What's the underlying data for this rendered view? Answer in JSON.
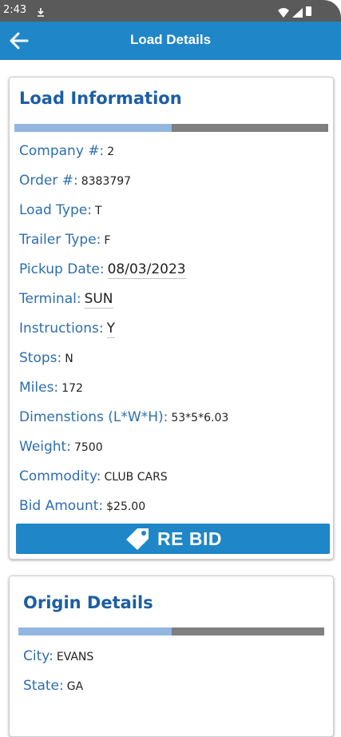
{
  "status_bar": {
    "time": "2:43",
    "notification_icon": "download-status-icon",
    "wifi_icon": "wifi-icon",
    "signal_icon": "cell-signal-icon",
    "battery_icon": "battery-icon"
  },
  "app_bar": {
    "title": "Load Details",
    "back_icon": "arrow-left-icon",
    "color": "#1f86c7"
  },
  "load_information": {
    "title": "Load Information",
    "progress_fraction": 0.5,
    "fields": [
      {
        "label": "Company #:",
        "value": "2"
      },
      {
        "label": "Order #:",
        "value": "8383797"
      },
      {
        "label": "Load Type:",
        "value": "T"
      },
      {
        "label": "Trailer Type:",
        "value": "F"
      },
      {
        "label": "Pickup Date:",
        "value": "08/03/2023"
      },
      {
        "label": "Terminal:",
        "value": "SUN"
      },
      {
        "label": "Instructions:",
        "value": "Y"
      },
      {
        "label": "Stops:",
        "value": "N"
      },
      {
        "label": "Miles:",
        "value": "172"
      },
      {
        "label": "Dimenstions (L*W*H):",
        "value": "53*5*6.03"
      },
      {
        "label": "Weight:",
        "value": "7500"
      },
      {
        "label": "Commodity:",
        "value": "CLUB CARS"
      },
      {
        "label": "Bid Amount:",
        "value": "$25.00"
      }
    ],
    "rebid_button": {
      "label": "RE BID",
      "icon": "price-tag-icon"
    }
  },
  "origin_details": {
    "title": "Origin Details",
    "progress_fraction": 0.5,
    "fields": [
      {
        "label": "City:",
        "value": "EVANS"
      },
      {
        "label": "State:",
        "value": "GA"
      }
    ]
  },
  "colors": {
    "accent": "#1f86c7",
    "heading": "#1c5ea2",
    "label": "#2d6eb0",
    "progress_fill": "#92b6df",
    "progress_track": "#7f7f7f"
  }
}
